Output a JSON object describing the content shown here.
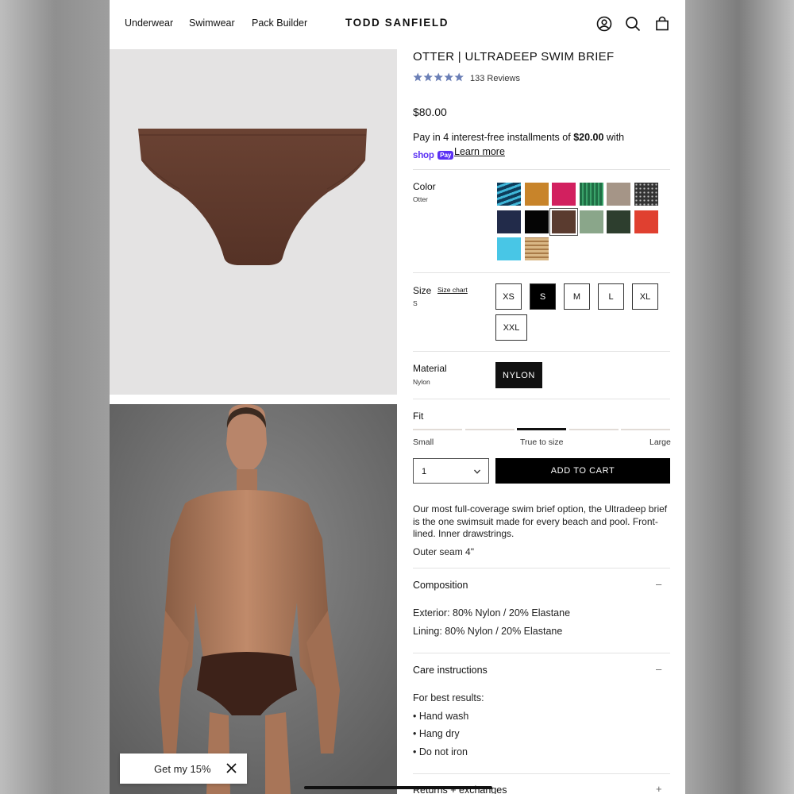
{
  "header": {
    "nav": [
      "Underwear",
      "Swimwear",
      "Pack Builder"
    ],
    "logo": "TODD SANFIELD",
    "icons": [
      "account-icon",
      "search-icon",
      "cart-icon"
    ]
  },
  "promo": {
    "label": "Get my 15%",
    "close_icon": "close-icon"
  },
  "product": {
    "title": "OTTER | ULTRADEEP SWIM BRIEF",
    "rating": 5,
    "reviews": "133 Reviews",
    "price": "$80.00",
    "installments": {
      "prefix": "Pay in 4 interest-free installments of ",
      "amount": "$20.00",
      "suffix": " with",
      "provider": "shop",
      "provider_badge": "Pay",
      "learn_more": "Learn more"
    },
    "color": {
      "label": "Color",
      "selected": "Otter",
      "swatches": [
        "#1a6b8f",
        "#c8842a",
        "#d2205f",
        "#2e8b57",
        "#a59587",
        "#333333",
        "#222b4a",
        "#050505",
        "#5a3b2f",
        "#8aa68a",
        "#2d3e2e",
        "#e04030",
        "#48c6e6",
        "#c8a878"
      ],
      "selected_index": 8
    },
    "size": {
      "label": "Size",
      "chart": "Size chart",
      "selected": "S",
      "options": [
        "XS",
        "S",
        "M",
        "L",
        "XL",
        "XXL"
      ]
    },
    "material": {
      "label": "Material",
      "selected": "Nylon",
      "option": "NYLON"
    },
    "fit": {
      "label": "Fit",
      "small": "Small",
      "true": "True to size",
      "large": "Large",
      "value_index": 2,
      "segments": 5
    },
    "quantity": "1",
    "add_to_cart": "ADD TO CART",
    "description": "Our most full-coverage swim brief option, the Ultradeep brief is the one swimsuit made for every beach and pool. Front-lined. Inner drawstrings.",
    "outer_seam": "Outer seam 4\"",
    "composition": {
      "title": "Composition",
      "toggle": "–",
      "lines": [
        "Exterior: 80% Nylon / 20% Elastane",
        "Lining: 80% Nylon / 20% Elastane"
      ]
    },
    "care": {
      "title": "Care instructions",
      "toggle": "–",
      "intro": "For best results:",
      "items": [
        "• Hand wash",
        "• Hang dry",
        "• Do not iron"
      ]
    },
    "returns": {
      "title": "Returns + exchanges",
      "toggle": "+"
    }
  },
  "colors": {
    "star": "#6b7fb6",
    "shop_pay": "#5a31f4"
  }
}
